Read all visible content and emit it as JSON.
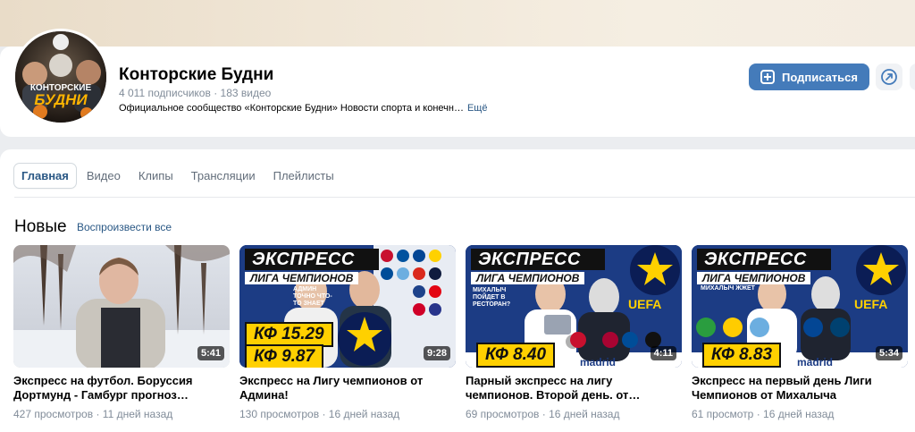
{
  "channel": {
    "avatar_text_line1": "КОНТОРСКИЕ",
    "avatar_text_line2": "БУДНИ",
    "name": "Конторские Будни",
    "subscribers": "4 011 подписчиков",
    "videos_count": "183 видео",
    "separator": "·",
    "description": "Официальное сообщество «Конторские Будни» Новости спорта и конечн…",
    "more_label": "Ещё",
    "subscribe_label": "Подписаться",
    "share_icon": "share-icon",
    "colors": {
      "accent": "#447bba",
      "link": "#2a5885",
      "muted": "#818c99"
    }
  },
  "tabs": [
    {
      "label": "Главная",
      "active": true
    },
    {
      "label": "Видео",
      "active": false
    },
    {
      "label": "Клипы",
      "active": false
    },
    {
      "label": "Трансляции",
      "active": false
    },
    {
      "label": "Плейлисты",
      "active": false
    }
  ],
  "section": {
    "title": "Новые",
    "play_all_label": "Воспроизвести все"
  },
  "videos": [
    {
      "title": "Экспресс на футбол. Боруссия Дортмунд - Гамбург прогноз…",
      "views": "427 просмотров",
      "age": "11 дней назад",
      "duration": "5:41"
    },
    {
      "title": "Экспресс на Лигу чемпионов от Админа!",
      "views": "130 просмотров",
      "age": "16 дней назад",
      "duration": "9:28",
      "thumb": {
        "headline": "ЭКСПРЕСС",
        "subline": "ЛИГА ЧЕМПИОНОВ",
        "caption": "АДМИН ТОЧНО ЧТО-ТО ЗНАЕТ",
        "kf1": "КФ 15.29",
        "kf2": "КФ 9.87"
      }
    },
    {
      "title": "Парный экспресс на лигу чемпионов. Второй день. от…",
      "views": "69 просмотров",
      "age": "16 дней назад",
      "duration": "4:11",
      "thumb": {
        "headline": "ЭКСПРЕСС",
        "subline": "ЛИГА ЧЕМПИОНОВ",
        "caption": "МИХАЛЫЧ ПОЙДЕТ В РЕСТОРАН?",
        "kf1": "КФ 8.40",
        "logo": "UEFA",
        "bottom": "madrid"
      }
    },
    {
      "title": "Экспресс на первый день Лиги Чемпионов от Михалыча",
      "views": "61 просмотр",
      "age": "16 дней назад",
      "duration": "5:34",
      "thumb": {
        "headline": "ЭКСПРЕСС",
        "subline": "ЛИГА ЧЕМПИОНОВ",
        "caption": "МИХАЛЫЧ ЖЖЕТ",
        "kf1": "КФ 8.83",
        "logo": "UEFA",
        "bottom": "madrid"
      }
    }
  ]
}
